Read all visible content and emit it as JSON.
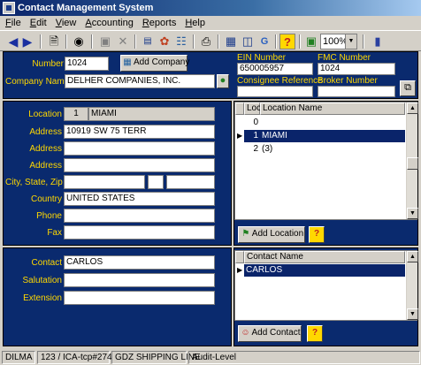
{
  "window": {
    "title": "Contact Management System"
  },
  "menu": [
    "File",
    "Edit",
    "View",
    "Accounting",
    "Reports",
    "Help"
  ],
  "toolbar": {
    "zoom": "100%"
  },
  "company": {
    "number_label": "Number",
    "number": "1024",
    "add_company": "Add Company",
    "name_label": "Company Name",
    "name": "DELHER COMPANIES, INC.",
    "ein_label": "EIN Number",
    "ein": "650005957",
    "fmc_label": "FMC Number",
    "fmc": "1024",
    "consignee_label": "Consignee Reference",
    "consignee": "",
    "broker_label": "Broker Number",
    "broker": ""
  },
  "location": {
    "location_label": "Location",
    "location_num": "1",
    "location_name": "MIAMI",
    "address_label": "Address",
    "address1": "10919 SW 75 TERR",
    "address2": "",
    "address3": "",
    "csz_label": "City, State, Zip",
    "city": "",
    "state": "",
    "zip": "",
    "country_label": "Country",
    "country": "UNITED STATES",
    "phone_label": "Phone",
    "phone": "",
    "fax_label": "Fax",
    "fax": "",
    "grid_headers": [
      "Loc",
      "Location Name"
    ],
    "grid_rows": [
      {
        "loc": "0",
        "name": ""
      },
      {
        "loc": "1",
        "name": "MIAMI"
      },
      {
        "loc": "2",
        "name": "(3)"
      }
    ],
    "add_location": "Add Location"
  },
  "contact": {
    "contact_label": "Contact",
    "contact": "CARLOS",
    "salutation_label": "Salutation",
    "salutation": "",
    "extension_label": "Extension",
    "extension": "",
    "grid_header": "Contact Name",
    "grid_rows": [
      "CARLOS"
    ],
    "add_contact": "Add Contact"
  },
  "help_label": "?",
  "status": [
    "DILMA",
    "123 / ICA-tcp#274",
    "GDZ SHIPPING LINE",
    "Audit-Level"
  ],
  "colors": {
    "panel": "#0a2a6e",
    "label": "#ffd800",
    "selection": "#0a246a"
  }
}
